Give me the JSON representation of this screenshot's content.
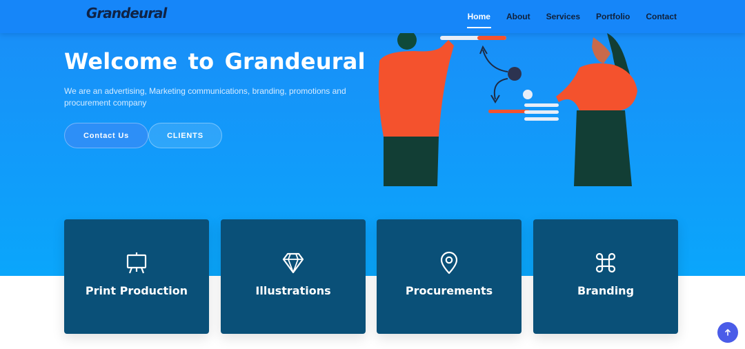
{
  "brand": {
    "logo": "Grandeural"
  },
  "nav": {
    "items": [
      "Home",
      "About",
      "Services",
      "Portfolio",
      "Contact"
    ],
    "active": "Home"
  },
  "hero": {
    "title": "Welcome to Grandeural",
    "subtitle": "We are an advertising, Marketing communications, branding, promotions and procurement company",
    "buttons": {
      "contact": "Contact Us",
      "clients": "CLIENTS"
    }
  },
  "services": [
    {
      "label": "Print Production",
      "icon": "easel-icon"
    },
    {
      "label": "Illustrations",
      "icon": "diamond-icon"
    },
    {
      "label": "Procurements",
      "icon": "map-pin-icon"
    },
    {
      "label": "Branding",
      "icon": "command-icon"
    }
  ],
  "colors": {
    "hero_gradient_top": "#1b8cf8",
    "hero_gradient_bottom": "#0aa6fb",
    "card_bg": "#0a5078",
    "scroll_button": "#4a5ce8",
    "illustration_accent": "#f4522d"
  },
  "scroll_top": {
    "icon": "arrow-up-icon"
  }
}
